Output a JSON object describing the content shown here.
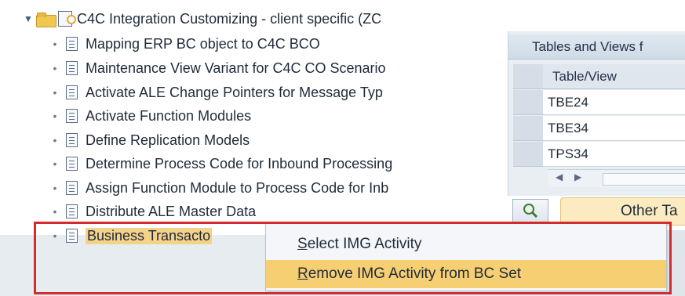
{
  "tree": {
    "root_label": "C4C Integration Customizing - client specific (ZC",
    "items": [
      {
        "label": "Mapping ERP BC object to C4C BCO"
      },
      {
        "label": "Maintenance View Variant for C4C CO Scenario"
      },
      {
        "label": "Activate ALE Change Pointers for Message Typ"
      },
      {
        "label": "Activate Function Modules"
      },
      {
        "label": "Define Replication Models"
      },
      {
        "label": "Determine Process Code for Inbound Processing"
      },
      {
        "label": "Assign Function Module to Process Code for Inb"
      },
      {
        "label": "Distribute ALE Master Data"
      },
      {
        "label": "Business Transacto"
      }
    ]
  },
  "table_panel": {
    "title": "Tables and Views f",
    "column_header": "Table/View",
    "rows": [
      "TBE24",
      "TBE34",
      "TPS34"
    ]
  },
  "other_tab_label": "Other Ta",
  "context_menu": {
    "items": [
      {
        "mnemonic": "S",
        "rest": "elect IMG Activity"
      },
      {
        "mnemonic": "R",
        "rest": "emove IMG Activity from BC Set"
      }
    ]
  },
  "colors": {
    "highlight": "#f5d28a",
    "menu_hover": "#f6cf72",
    "annotation_frame": "#d22c2c",
    "panel_bg": "#e9eef3"
  },
  "icons": [
    "expand-arrow-icon",
    "folder-icon",
    "customizing-icon",
    "document-icon",
    "find-icon",
    "scroll-left-icon",
    "scroll-right-icon"
  ]
}
